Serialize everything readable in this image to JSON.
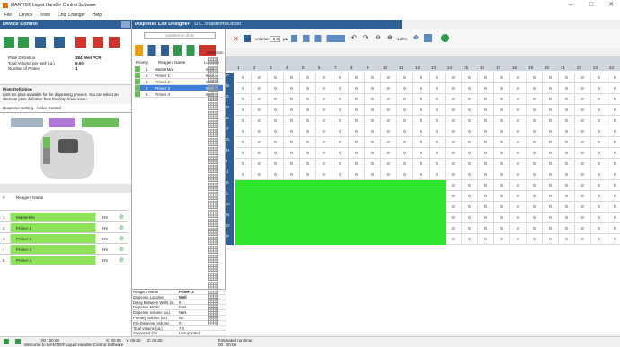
{
  "app": {
    "title": "MANTIS® Liquid Handler Control Software",
    "controls": [
      "–",
      "□",
      "✕"
    ]
  },
  "menu": [
    "File",
    "Device",
    "Tools",
    "Chip Changer",
    "Help"
  ],
  "device_control": {
    "header": "Device Control",
    "plate_definition_label": "Plate Definition",
    "plate_definition_value": "384 Well PCR",
    "total_volume_label": "Total Volume per well (uL)",
    "total_volume_value": "9.00",
    "num_plates_label": "Number of Plates",
    "num_plates_value": "1",
    "help_title": "Plate Definition",
    "help_text": "Lists the plate available for the dispensing process. You can select an alternate plate definition from the drop-down menu.",
    "tabs": [
      "Dispense Setting",
      "Valve Control"
    ],
    "reagent_header": [
      "#",
      "Reagent Name"
    ],
    "reagents": [
      {
        "n": "1",
        "name": "MasterMix",
        "v": "HV"
      },
      {
        "n": "2",
        "name": "Primer 1",
        "v": "HV"
      },
      {
        "n": "3",
        "name": "Primer 2",
        "v": "HV"
      },
      {
        "n": "4",
        "name": "Primer 3",
        "v": "HV"
      },
      {
        "n": "5",
        "name": "Primer 4",
        "v": "HV"
      }
    ]
  },
  "designer": {
    "header": "Dispense List Designer",
    "path": "D:\\...\\mastermix.dl.txt",
    "search_placeholder": "mastermix dl.txt",
    "volume_label": "volume:",
    "volume_value": "0.0",
    "volume_unit": "µL",
    "zoom": "125%",
    "selection_label": "Selection",
    "list_header": [
      "Priority",
      "Reagent Name",
      "Location"
    ],
    "list": [
      {
        "p": "1",
        "name": "MasterMix",
        "loc": "Well"
      },
      {
        "p": "2",
        "name": "Primer 1",
        "loc": "Well"
      },
      {
        "p": "3",
        "name": "Primer 2",
        "loc": "Well"
      },
      {
        "p": "4",
        "name": "Primer 3",
        "loc": "Well"
      },
      {
        "p": "5",
        "name": "Primer 4",
        "loc": "Well"
      }
    ],
    "props": [
      [
        "Reagent Name",
        "Primer 3"
      ],
      [
        "Dispense Location",
        "Well"
      ],
      [
        "Delay Between Wells (s)",
        "0"
      ],
      [
        "Dispense Mode",
        "Fast"
      ],
      [
        "Dispense Volume (uL)",
        "NaN"
      ],
      [
        "Primary Volume (uL)",
        "No"
      ],
      [
        "Pre-Dispense Volume",
        "0"
      ],
      [
        "Total Volume (uL)",
        "7.0"
      ],
      [
        "Supported Chi",
        "Unsupported"
      ]
    ]
  },
  "plate": {
    "cols": [
      "1",
      "2",
      "3",
      "4",
      "5",
      "6",
      "7",
      "8",
      "9",
      "10",
      "11",
      "12",
      "13",
      "14",
      "15",
      "16",
      "17",
      "18",
      "19",
      "20",
      "21",
      "22",
      "23",
      "24"
    ],
    "rows": [
      "A",
      "B",
      "C",
      "D",
      "E",
      "F",
      "G",
      "H",
      "I",
      "J",
      "K",
      "L",
      "M",
      "N",
      "O",
      "P"
    ],
    "value": "0"
  },
  "status": {
    "x": "X: 00.00",
    "y": "Y: 00.00",
    "z": "Z: 00.00",
    "elapsed": "00 : 00.00",
    "msg": "Welcome to MANTIS® Liquid Handler Control Software",
    "est_label": "Estimated run time",
    "est_value": "00 : 00.00"
  }
}
